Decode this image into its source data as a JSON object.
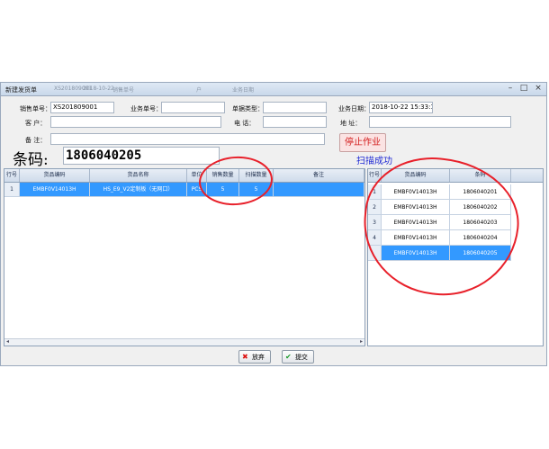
{
  "window": {
    "title": "新建发货单",
    "blurred_tabs": [
      "XS201809001",
      "2018-10-22",
      "销售单号",
      "户",
      "业务日期"
    ]
  },
  "form": {
    "order_no_label": "销售单号：",
    "order_no_value": "XS201809001",
    "biz_no_label": "业务单号：",
    "biz_no_value": "",
    "doc_type_label": "单据类型：",
    "doc_type_value": "",
    "biz_date_label": "业务日期：",
    "biz_date_value": "2018-10-22 15:33:11",
    "customer_label": "客    户：",
    "customer_value": "",
    "phone_label": "电    话：",
    "phone_value": "",
    "address_label": "地    址：",
    "address_value": "",
    "remark_label": "备    注：",
    "remark_value": ""
  },
  "scan": {
    "barcode_label": "条码:",
    "barcode_value": "1806040205",
    "stop_button": "停止作业",
    "status_text": "扫描成功"
  },
  "left_grid": {
    "headers": [
      "行号",
      "货品编码",
      "货品名称",
      "单位",
      "销售数量",
      "扫描数量",
      "备注"
    ],
    "rows": [
      {
        "no": "1",
        "code": "EMBF0V14013H",
        "name": "HS_E9_V2定制板（无网口）",
        "unit": "PCS",
        "sale_qty": "5",
        "scan_qty": "5",
        "remark": ""
      }
    ]
  },
  "right_grid": {
    "headers": [
      "行号",
      "货品编码",
      "条码"
    ],
    "rows": [
      {
        "no": "1",
        "code": "EMBF0V14013H",
        "barcode": "1806040201"
      },
      {
        "no": "2",
        "code": "EMBF0V14013H",
        "barcode": "1806040202"
      },
      {
        "no": "3",
        "code": "EMBF0V14013H",
        "barcode": "1806040203"
      },
      {
        "no": "4",
        "code": "EMBF0V14013H",
        "barcode": "1806040204"
      },
      {
        "no": "",
        "code": "EMBF0V14013H",
        "barcode": "1806040205"
      }
    ]
  },
  "buttons": {
    "discard": "放弃",
    "submit": "提交"
  },
  "colors": {
    "selection": "#3399ff",
    "annotation": "#e8202a",
    "stop_text": "#d31a1a",
    "success_text": "#1f29d4"
  }
}
